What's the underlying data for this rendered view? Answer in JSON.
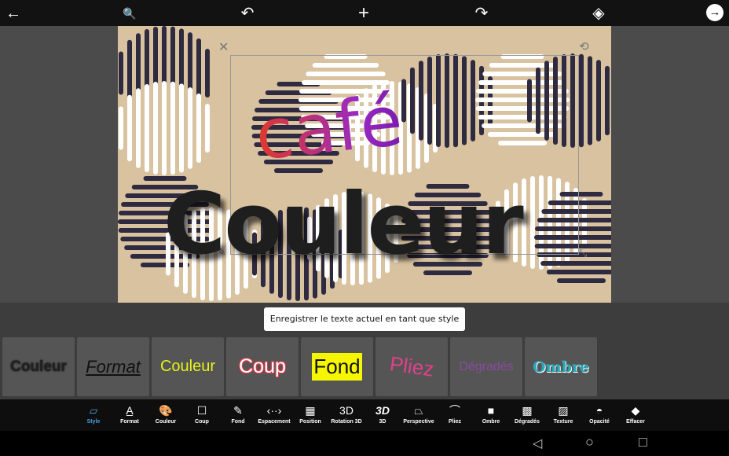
{
  "topbar": {
    "back": "←",
    "zoom": "🔍",
    "undo": "↶",
    "add": "+",
    "redo": "↷",
    "layers": "◈",
    "next": "→"
  },
  "canvas": {
    "text_cafe": "café",
    "text_main": "Couleur"
  },
  "tooltip": "Enregistrer le texte actuel en tant que style",
  "styles_close": "✕",
  "styles": [
    {
      "label": "Couleur",
      "color": "#222"
    },
    {
      "label": "Format",
      "color": "#111"
    },
    {
      "label": "Couleur",
      "color": "#e6f21a"
    },
    {
      "label": "Coup",
      "color": "#ffffff"
    },
    {
      "label": "Fond",
      "color": "#111"
    },
    {
      "label": "Pliez",
      "color": "#e0408a"
    },
    {
      "label": "Dégradés",
      "color": "#8a4aa0"
    },
    {
      "label": "Ombre",
      "color": "#2aa8b8"
    }
  ],
  "tools": [
    {
      "label": "Style",
      "icon": "▱",
      "active": true
    },
    {
      "label": "Format",
      "icon": "A̲"
    },
    {
      "label": "Couleur",
      "icon": "🎨"
    },
    {
      "label": "Coup",
      "icon": "☐"
    },
    {
      "label": "Fond",
      "icon": "✎"
    },
    {
      "label": "Espacement",
      "icon": "‹··›"
    },
    {
      "label": "Position",
      "icon": "▦"
    },
    {
      "label": "Rotation 3D",
      "icon": "3D"
    },
    {
      "label": "3D",
      "icon": "3D"
    },
    {
      "label": "Perspective",
      "icon": "⏢"
    },
    {
      "label": "Pliez",
      "icon": "⌒"
    },
    {
      "label": "Ombre",
      "icon": "■"
    },
    {
      "label": "Dégradés",
      "icon": "▩"
    },
    {
      "label": "Texture",
      "icon": "▨"
    },
    {
      "label": "Opacité",
      "icon": "◓"
    },
    {
      "label": "Effacer",
      "icon": "◆"
    }
  ],
  "nav": {
    "back": "◁",
    "home": "○",
    "recent": "□"
  },
  "colors": {
    "accent": "#4a9fe0",
    "canvas": "#d8c2a0"
  }
}
